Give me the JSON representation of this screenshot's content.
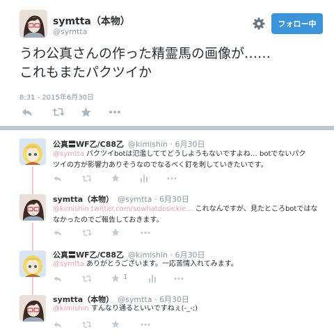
{
  "main_tweet": {
    "author_name": "symtta（本物）",
    "author_handle": "@symtta",
    "follow_label": "フォロー中",
    "text_lines": [
      "うわ公真さんの作った精霊馬の画像が……",
      "これもまたパクツイか"
    ],
    "timestamp": "8:31 - 2015年6月30日"
  },
  "replies": [
    {
      "name": "公真〓WF乙/C88乙",
      "meta": "@kimishin · 6月30日",
      "lines": [
        {
          "mention": "@symtta",
          "text": " パクツイbotは氾濫しててどうしようもないですよね… botでないパク"
        },
        {
          "mention": "",
          "text": "ツイの方が影響力ありそうなのでなるべく釘を刺していきたいです。"
        }
      ]
    },
    {
      "name": "symtta（本物）",
      "meta": "@symtta · 6月30日",
      "lines": [
        {
          "mention": "@kimishin twitter.com/sowhatdosickie…",
          "text": " これなんですが、見たところbotではな"
        },
        {
          "mention": "",
          "text": "なかったのでご報告しておきます。"
        }
      ]
    },
    {
      "name": "公真〓WF乙/C88乙",
      "meta": "@kimishin · 6月30日",
      "lines": [
        {
          "mention": "@symtta",
          "text": " ありがとうございます。一応苦情入れてみます。"
        }
      ],
      "retweet_count": "1"
    },
    {
      "name": "symtta（本物）",
      "meta": "@symtta · 6月30日",
      "lines": [
        {
          "mention": "@kimishin",
          "text": " すんなり通るといいですねぇ(-_-;)"
        }
      ]
    }
  ],
  "icons": {
    "settings": "gear-icon",
    "reply": "reply-icon",
    "retweet": "retweet-icon",
    "favorite": "star-icon",
    "more": "more-icon",
    "analytics": "analytics-icon"
  },
  "colors": {
    "accent": "#3b94d9",
    "mention": "#e8a0b0",
    "muted": "#8899a6",
    "icon": "#aab8c2",
    "thread": "#f4c6d2"
  }
}
